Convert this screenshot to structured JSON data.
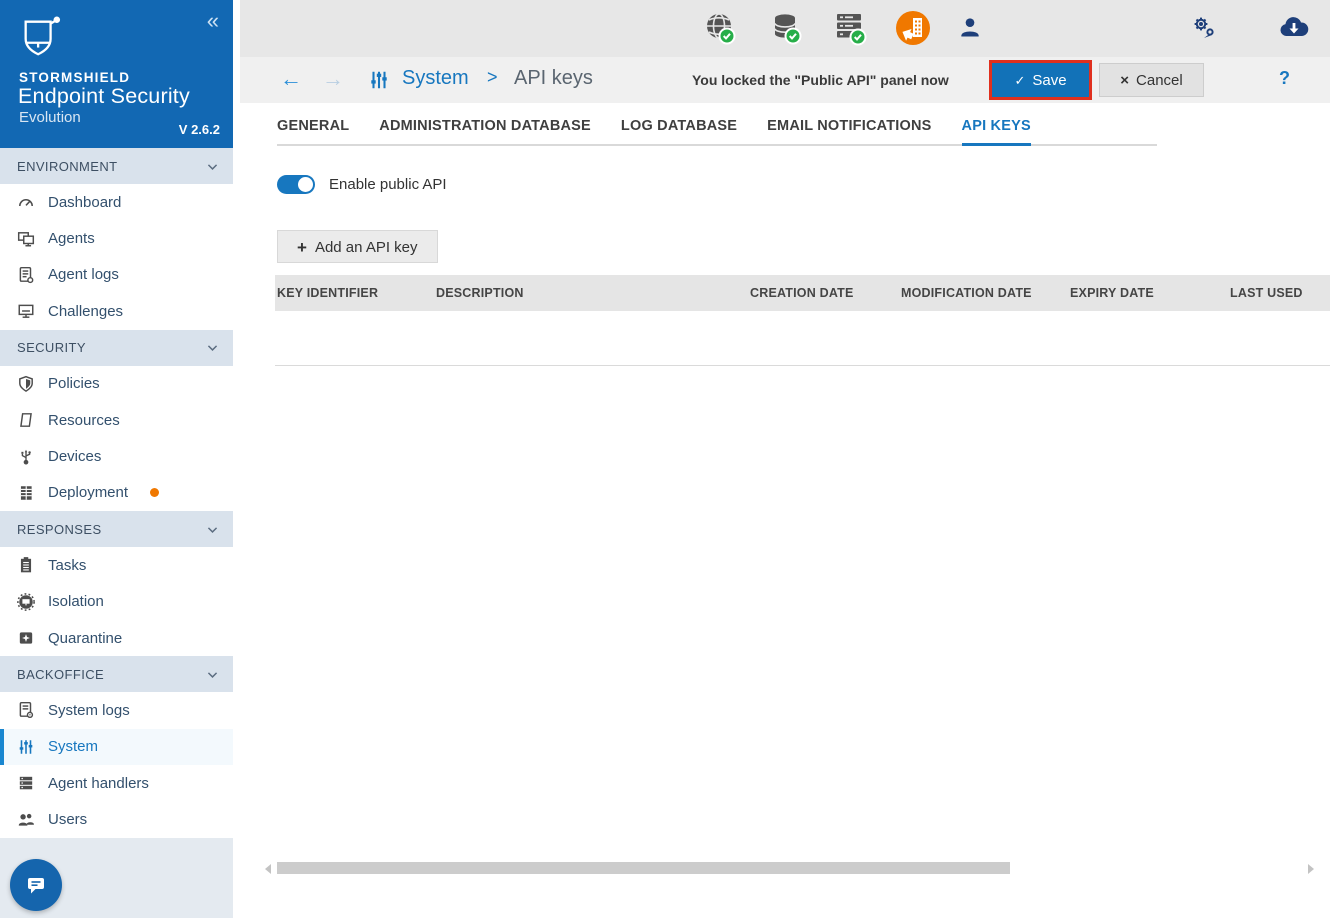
{
  "brand": {
    "company": "STORMSHIELD",
    "product": "Endpoint Security",
    "edition": "Evolution",
    "version": "V 2.6.2"
  },
  "glyphs": {
    "collapse": "«",
    "back": "←",
    "forward": "→",
    "crumb_separator": ">",
    "help": "?",
    "add_plus": "+",
    "save_check": "✓",
    "cancel_x": "×"
  },
  "sidebar": {
    "sections": [
      {
        "label": "ENVIRONMENT",
        "items": [
          {
            "label": "Dashboard",
            "icon": "dashboard-icon"
          },
          {
            "label": "Agents",
            "icon": "agents-icon"
          },
          {
            "label": "Agent logs",
            "icon": "agent-logs-icon"
          },
          {
            "label": "Challenges",
            "icon": "challenges-icon"
          }
        ]
      },
      {
        "label": "SECURITY",
        "items": [
          {
            "label": "Policies",
            "icon": "policies-icon"
          },
          {
            "label": "Resources",
            "icon": "resources-icon"
          },
          {
            "label": "Devices",
            "icon": "devices-icon"
          },
          {
            "label": "Deployment",
            "icon": "deployment-icon",
            "badge": "orange-dot"
          }
        ]
      },
      {
        "label": "RESPONSES",
        "items": [
          {
            "label": "Tasks",
            "icon": "tasks-icon"
          },
          {
            "label": "Isolation",
            "icon": "isolation-icon"
          },
          {
            "label": "Quarantine",
            "icon": "quarantine-icon"
          }
        ]
      },
      {
        "label": "BACKOFFICE",
        "items": [
          {
            "label": "System logs",
            "icon": "system-logs-icon"
          },
          {
            "label": "System",
            "icon": "system-icon",
            "active": true
          },
          {
            "label": "Agent handlers",
            "icon": "agent-handlers-icon"
          },
          {
            "label": "Users",
            "icon": "users-icon"
          }
        ]
      }
    ]
  },
  "topbar": {
    "status_icons": [
      {
        "name": "internet-status-icon",
        "state": "ok"
      },
      {
        "name": "database-status-icon",
        "state": "ok"
      },
      {
        "name": "server-status-icon",
        "state": "ok"
      },
      {
        "name": "deployment-pending-icon",
        "state": "alert"
      },
      {
        "name": "user-account-icon"
      },
      {
        "name": "services-icon"
      },
      {
        "name": "cloud-download-icon"
      }
    ]
  },
  "breadcrumb": {
    "section": "System",
    "page": "API keys"
  },
  "actionbar": {
    "notification": "You locked the \"Public API\" panel now",
    "save_label": "Save",
    "cancel_label": "Cancel"
  },
  "tabs": {
    "items": [
      {
        "label": "GENERAL"
      },
      {
        "label": "ADMINISTRATION DATABASE"
      },
      {
        "label": "LOG DATABASE"
      },
      {
        "label": "EMAIL NOTIFICATIONS"
      },
      {
        "label": "API KEYS",
        "active": true
      }
    ]
  },
  "panel": {
    "toggle_label": "Enable public API",
    "toggle_state": "on",
    "add_button_label": "Add an API key",
    "table": {
      "headers": [
        "KEY IDENTIFIER",
        "DESCRIPTION",
        "CREATION DATE",
        "MODIFICATION DATE",
        "EXPIRY DATE",
        "LAST USED"
      ],
      "rows": []
    }
  },
  "colors": {
    "brand_blue": "#1268b3",
    "accent_blue": "#1777bf",
    "alert_orange": "#f07800",
    "ok_green": "#27ae49",
    "annotation_red": "#e0301e",
    "navy": "#1e3f7a"
  }
}
